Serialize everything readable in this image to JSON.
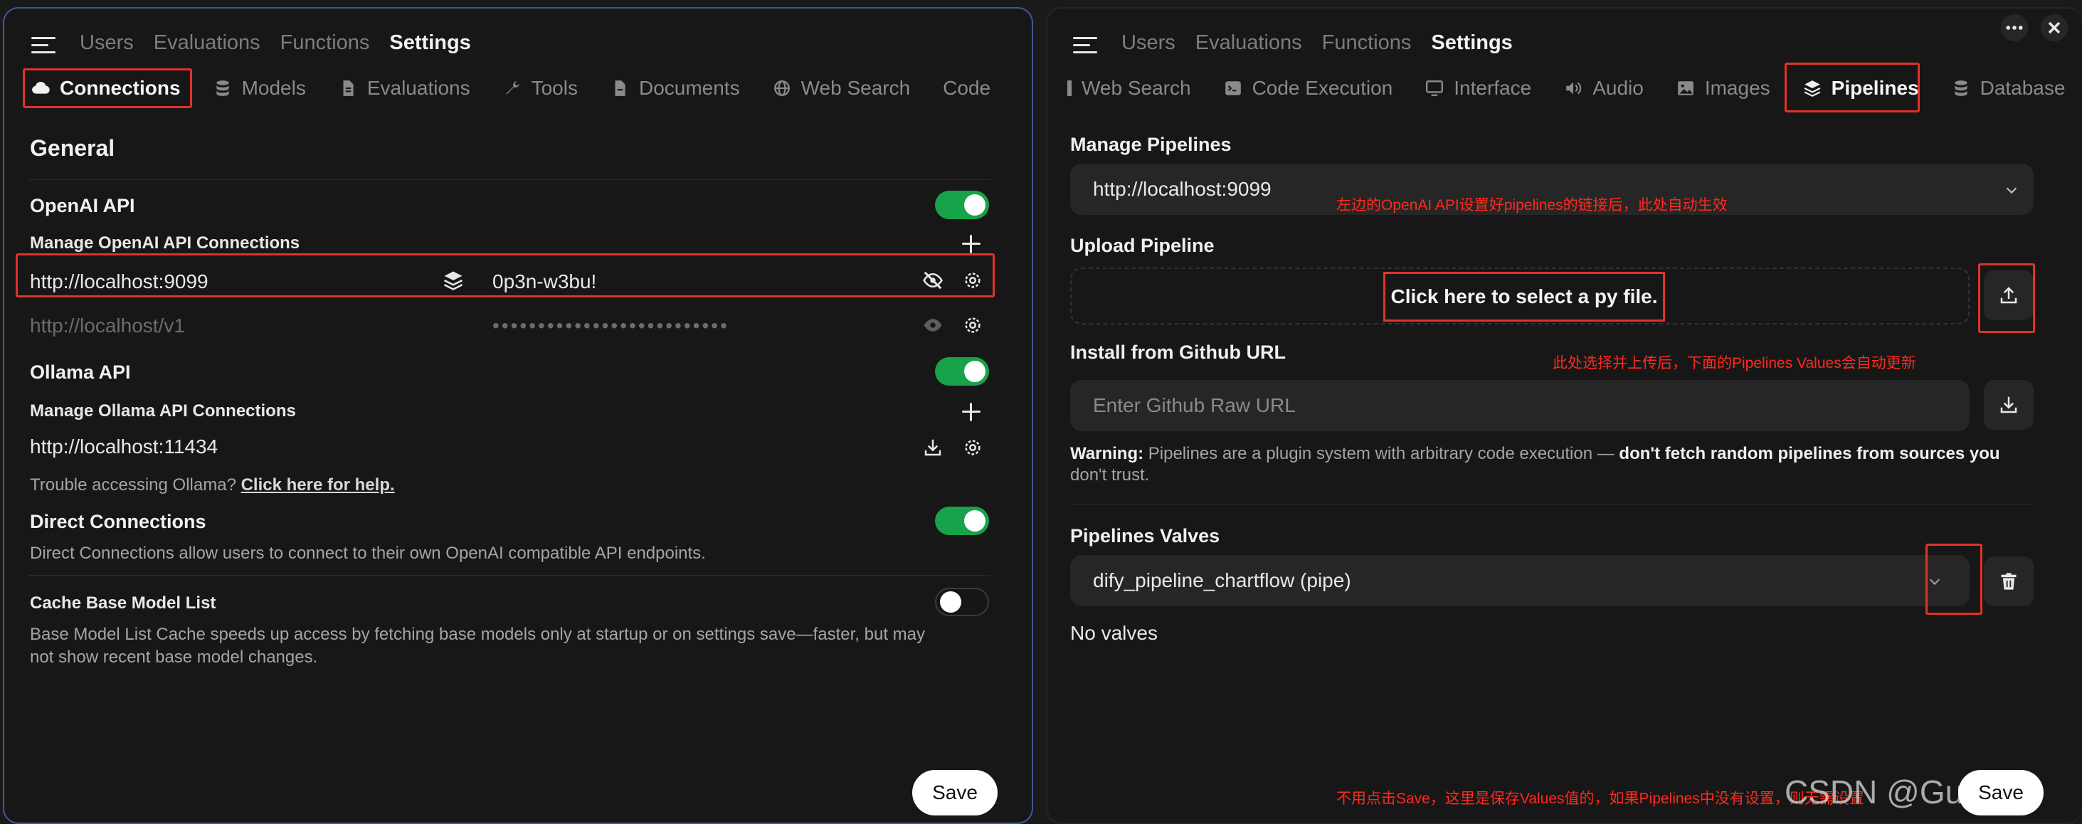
{
  "left": {
    "top_nav": [
      "Users",
      "Evaluations",
      "Functions",
      "Settings"
    ],
    "tabs": [
      "Connections",
      "Models",
      "Evaluations",
      "Tools",
      "Documents",
      "Web Search",
      "Code"
    ],
    "section_title": "General",
    "openai": {
      "title": "OpenAI API",
      "manage_label": "Manage OpenAI API Connections",
      "connections": [
        {
          "url": "http://localhost:9099",
          "key": "0p3n-w3bu!"
        },
        {
          "url": "http://localhost/v1",
          "key": "••••••••••••••••••••••••••"
        }
      ]
    },
    "ollama": {
      "title": "Ollama API",
      "manage_label": "Manage Ollama API Connections",
      "url": "http://localhost:11434",
      "help_text": "Trouble accessing Ollama?",
      "help_link": "Click here for help."
    },
    "direct": {
      "title": "Direct Connections",
      "desc": "Direct Connections allow users to connect to their own OpenAI compatible API endpoints."
    },
    "cache": {
      "title": "Cache Base Model List",
      "desc_line1": "Base Model List Cache speeds up access by fetching base models only at startup or on settings save—faster, but may",
      "desc_line2": "not show recent base model changes."
    },
    "save_label": "Save"
  },
  "right": {
    "top_nav": [
      "Users",
      "Evaluations",
      "Functions",
      "Settings"
    ],
    "tabs": [
      "Web Search",
      "Code Execution",
      "Interface",
      "Audio",
      "Images",
      "Pipelines",
      "Database"
    ],
    "manage_title": "Manage Pipelines",
    "pipeline_url": "http://localhost:9099",
    "annotation1": "左边的OpenAI API设置好pipelines的链接后，此处自动生效",
    "upload_title": "Upload Pipeline",
    "upload_label": "Click here to select a py file.",
    "install_title": "Install from Github URL",
    "annotation2": "此处选择并上传后，下面的Pipelines Values会自动更新",
    "github_placeholder": "Enter Github Raw URL",
    "warning_bold": "Warning:",
    "warning_text": " Pipelines are a plugin system with arbitrary code execution — ",
    "warning_bold2": "don't fetch random pipelines from sources you",
    "warning_line2": "don't trust.",
    "valves_title": "Pipelines Valves",
    "valve_selected": "dify_pipeline_chartflow (pipe)",
    "no_valves": "No valves",
    "annotation3": "不用点击Save，这里是保存Values值的，如果Pipelines中没有设置，则无需设置",
    "watermark": "CSDN @GuokLiu",
    "save_label": "Save"
  },
  "colors": {
    "accent_green": "#16a34a",
    "annotation_red": "#e0322a",
    "panel_bg": "#171717"
  }
}
